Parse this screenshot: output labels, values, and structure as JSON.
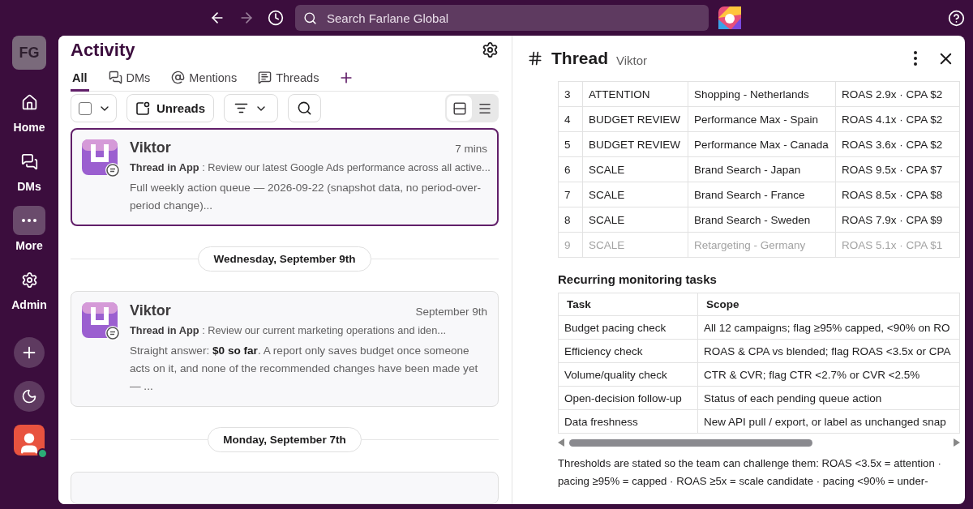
{
  "topbar": {
    "search": {
      "placeholder": "Search Farlane Global"
    }
  },
  "sidebar": {
    "workspace": "FG",
    "items": [
      {
        "kind": "home",
        "label": "Home",
        "selected": false
      },
      {
        "kind": "dms",
        "label": "DMs",
        "selected": false
      },
      {
        "kind": "more",
        "label": "More",
        "selected": true
      },
      {
        "kind": "admin",
        "label": "Admin",
        "selected": false
      }
    ]
  },
  "activity": {
    "title": "Activity",
    "tabs": [
      {
        "kind": "plain",
        "label": "All",
        "selected": true
      },
      {
        "kind": "dms",
        "label": "DMs",
        "selected": false
      },
      {
        "kind": "mentions",
        "label": "Mentions",
        "selected": false
      },
      {
        "kind": "threads",
        "label": "Threads",
        "selected": false
      }
    ],
    "toolbar": {
      "unreads": "Unreads",
      "views": [
        {
          "kind": "cards",
          "selected": true
        },
        {
          "kind": "list",
          "selected": false
        }
      ]
    },
    "feed": [
      {
        "kind": "message",
        "selected": true,
        "sender": "Viktor",
        "time": "7 mins",
        "source": "Thread in App",
        "context": ": Review our latest Google Ads performance across all active...",
        "body": "Full weekly action queue — 2026-09-22 (snapshot data, no period-over-period change)..."
      },
      {
        "kind": "date",
        "label": "Wednesday, September 9th"
      },
      {
        "kind": "message",
        "selected": false,
        "sender": "Viktor",
        "time": "September 9th",
        "source": "Thread in App",
        "context": ": Review our current marketing operations and iden...",
        "body": "Straight answer: **$0 so far**. A report only saves budget once someone acts on it, and none of the recommended changes have been made yet — ..."
      },
      {
        "kind": "date",
        "label": "Monday, September 7th"
      }
    ]
  },
  "thread": {
    "title": "Thread",
    "subtitle": "Viktor",
    "queue_rows": [
      {
        "faded": false,
        "cells": [
          "3",
          "ATTENTION",
          "Shopping - Netherlands",
          "ROAS 2.9x · CPA $2"
        ]
      },
      {
        "faded": false,
        "cells": [
          "4",
          "BUDGET REVIEW",
          "Performance Max - Spain",
          "ROAS 4.1x · CPA $2"
        ]
      },
      {
        "faded": false,
        "cells": [
          "5",
          "BUDGET REVIEW",
          "Performance Max - Canada",
          "ROAS 3.6x · CPA $2"
        ]
      },
      {
        "faded": false,
        "cells": [
          "6",
          "SCALE",
          "Brand Search - Japan",
          "ROAS 9.5x · CPA $7"
        ]
      },
      {
        "faded": false,
        "cells": [
          "7",
          "SCALE",
          "Brand Search - France",
          "ROAS 8.5x · CPA $8"
        ]
      },
      {
        "faded": false,
        "cells": [
          "8",
          "SCALE",
          "Brand Search - Sweden",
          "ROAS 7.9x · CPA $9"
        ]
      },
      {
        "faded": true,
        "cells": [
          "9",
          "SCALE",
          "Retargeting - Germany",
          "ROAS 5.1x · CPA $1"
        ]
      }
    ],
    "monitoring": {
      "heading": "Recurring monitoring tasks",
      "columns": [
        "Task",
        "Scope"
      ],
      "rows": [
        [
          "Budget pacing check",
          "All 12 campaigns; flag ≥95% capped, <90% on RO"
        ],
        [
          "Efficiency check",
          "ROAS & CPA vs blended; flag ROAS <3.5x or CPA"
        ],
        [
          "Volume/quality check",
          "CTR & CVR; flag CTR <2.7% or CVR <2.5%"
        ],
        [
          "Open-decision follow-up",
          "Status of each pending queue action"
        ],
        [
          "Data freshness",
          "New API pull / export, or label as unchanged snap"
        ]
      ]
    },
    "note_lines": [
      "Thresholds are stated so the team can challenge them: ROAS <3.5x = attention ·",
      "pacing ≥95% = capped · ROAS ≥5x = scale candidate · pacing <90% = under-"
    ]
  }
}
